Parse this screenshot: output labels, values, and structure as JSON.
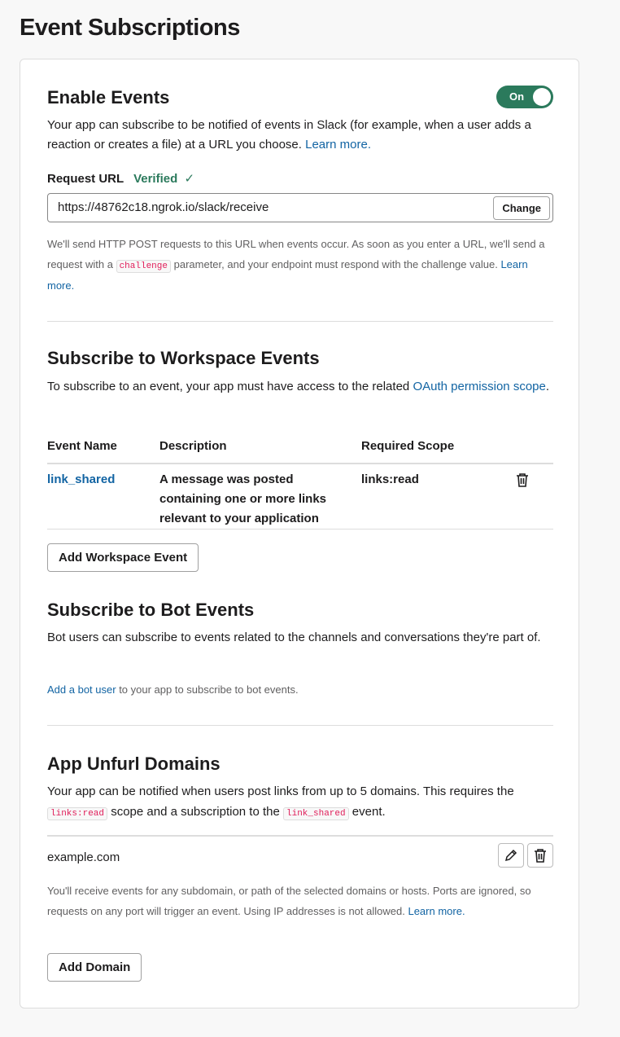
{
  "page_title": "Event Subscriptions",
  "enable_events": {
    "heading": "Enable Events",
    "toggle_label": "On",
    "toggle_on": true,
    "description": "Your app can subscribe to be notified of events in Slack (for example, when a user adds a reaction or creates a file) at a URL you choose.",
    "learn_more": "Learn more.",
    "request_url_label": "Request URL",
    "verified_label": "Verified",
    "request_url_value": "https://48762c18.ngrok.io/slack/receive",
    "change_button": "Change",
    "help_part1": "We'll send HTTP POST requests to this URL when events occur. As soon as you enter a URL, we'll send a request with a",
    "help_code": "challenge",
    "help_part2": "parameter, and your endpoint must respond with the challenge value.",
    "help_learn_more": "Learn more."
  },
  "workspace_events": {
    "heading": "Subscribe to Workspace Events",
    "description": "To subscribe to an event, your app must have access to the related",
    "oauth_link": "OAuth permission scope",
    "columns": [
      "Event Name",
      "Description",
      "Required Scope"
    ],
    "rows": [
      {
        "event": "link_shared",
        "description": "A message was posted containing one or more links relevant to your application",
        "scope": "links:read"
      }
    ],
    "add_button": "Add Workspace Event"
  },
  "bot_events": {
    "heading": "Subscribe to Bot Events",
    "description": "Bot users can subscribe to events related to the channels and conversations they're part of.",
    "add_bot_link": "Add a bot user",
    "add_bot_text": "to your app to subscribe to bot events."
  },
  "unfurl": {
    "heading": "App Unfurl Domains",
    "desc_part1": "Your app can be notified when users post links from up to 5 domains. This requires the",
    "code1": "links:read",
    "desc_part2": "scope and a subscription to the",
    "code2": "link_shared",
    "desc_part3": "event.",
    "domains": [
      "example.com"
    ],
    "help": "You'll receive events for any subdomain, or path of the selected domains or hosts. Ports are ignored, so requests on any port will trigger an event. Using IP addresses is not allowed.",
    "help_learn_more": "Learn more.",
    "add_button": "Add Domain"
  },
  "colors": {
    "accent": "#2b7a5c",
    "link": "#1264a3",
    "code": "#e01e5a"
  }
}
